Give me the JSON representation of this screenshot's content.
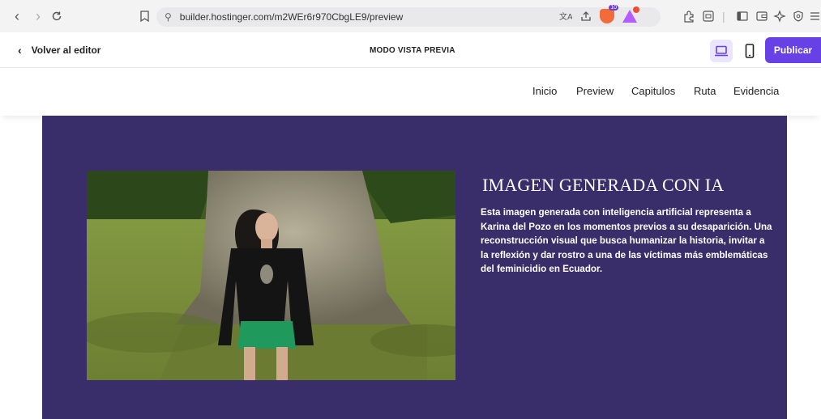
{
  "browser": {
    "url": "builder.hostinger.com/m2WEr6r970CbgLE9/preview",
    "brave_badge": "10"
  },
  "editor": {
    "back_label": "Volver al editor",
    "mode_label": "MODO VISTA PREVIA",
    "publish_label": "Publicar"
  },
  "site_nav": [
    "Inicio",
    "Preview",
    "Capitulos",
    "Ruta",
    "Evidencia"
  ],
  "content": {
    "headline": "IMAGEN GENERADA CON IA",
    "body": "Esta imagen generada con inteligencia artificial representa a Karina del Pozo en los momentos previos a su desaparición. Una reconstrucción visual que busca humanizar la historia, invitar a la reflexión y dar rostro a una de las víctimas más emblemáticas del feminicidio en Ecuador."
  },
  "colors": {
    "section_bg": "#3a2e6a",
    "accent": "#6740e6"
  }
}
